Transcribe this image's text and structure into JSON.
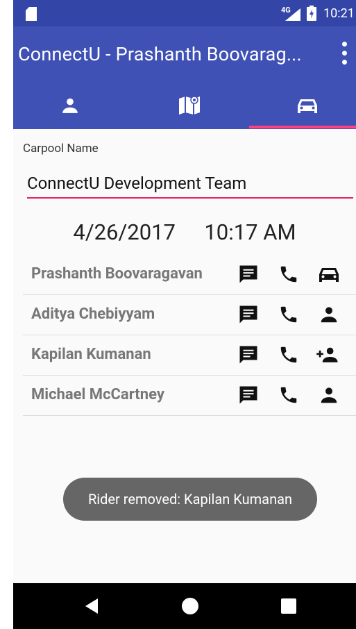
{
  "status_bar": {
    "network": "4G",
    "time": "10:21"
  },
  "app_bar": {
    "title": "ConnectU - Prashanth Boovarag..."
  },
  "tabs": [
    {
      "icon": "person-icon"
    },
    {
      "icon": "map-icon"
    },
    {
      "icon": "car-icon",
      "selected": true
    }
  ],
  "carpool": {
    "label": "Carpool Name",
    "value": "ConnectU Development Team"
  },
  "datetime": {
    "date": "4/26/2017",
    "time": "10:17 AM"
  },
  "members": [
    {
      "name": "Prashanth Boovaragavan",
      "action_icon": "car-icon"
    },
    {
      "name": "Aditya Chebiyyam",
      "action_icon": "person-icon"
    },
    {
      "name": "Kapilan Kumanan",
      "action_icon": "person-add-icon"
    },
    {
      "name": "Michael McCartney",
      "action_icon": "person-icon"
    }
  ],
  "toast": {
    "text": "Rider removed: Kapilan Kumanan"
  },
  "colors": {
    "primary": "#3f51b5",
    "status_bar": "#3445a8",
    "accent": "#ff4081",
    "underline": "#e91e63"
  }
}
